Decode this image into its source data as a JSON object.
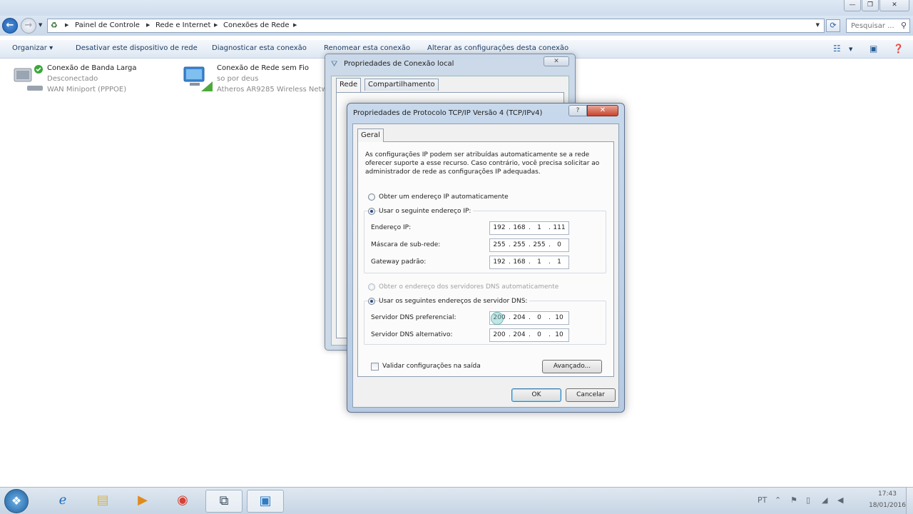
{
  "explorer": {
    "window_controls": {
      "minimize": "—",
      "maximize": "❐",
      "close": "✕"
    },
    "breadcrumb": [
      "Painel de Controle",
      "Rede e Internet",
      "Conexões de Rede"
    ],
    "search_placeholder": "Pesquisar ...",
    "toolbar": {
      "organize": "Organizar ▾",
      "disable": "Desativar este dispositivo de rede",
      "diagnose": "Diagnosticar esta conexão",
      "rename": "Renomear esta conexão",
      "change": "Alterar as configurações desta conexão"
    },
    "connections": [
      {
        "name": "Conexão de Banda Larga",
        "status": "Desconectado",
        "device": "WAN Miniport (PPPOE)"
      },
      {
        "name": "Conexão de Rede sem Fio",
        "status": "so por deus",
        "device": "Atheros AR9285 Wireless Netw"
      }
    ]
  },
  "local_conn_dialog": {
    "title": "Propriedades de Conexão local",
    "close": "✕",
    "tabs": [
      "Rede",
      "Compartilhamento"
    ]
  },
  "tcpip_dialog": {
    "title": "Propriedades de Protocolo TCP/IP Versão 4 (TCP/IPv4)",
    "help": "?",
    "close": "✕",
    "tab": "Geral",
    "intro": "As configurações IP podem ser atribuídas automaticamente se a rede oferecer suporte a esse recurso. Caso contrário, você precisa solicitar ao administrador de rede as configurações IP adequadas.",
    "radio_auto_ip": "Obter um endereço IP automaticamente",
    "radio_manual_ip": "Usar o seguinte endereço IP:",
    "ip_label": "Endereço IP:",
    "ip": [
      "192",
      "168",
      "1",
      "111"
    ],
    "mask_label": "Máscara de sub-rede:",
    "mask": [
      "255",
      "255",
      "255",
      "0"
    ],
    "gateway_label": "Gateway padrão:",
    "gateway": [
      "192",
      "168",
      "1",
      "1"
    ],
    "radio_auto_dns": "Obter o endereço dos servidores DNS automaticamente",
    "radio_manual_dns": "Usar os seguintes endereços de servidor DNS:",
    "dns_pref_label": "Servidor DNS preferencial:",
    "dns_pref": [
      "200",
      "204",
      "0",
      "10"
    ],
    "dns_alt_label": "Servidor DNS alternativo:",
    "dns_alt": [
      "200",
      "204",
      "0",
      "10"
    ],
    "validate_label": "Validar configurações na saída",
    "advanced": "Avançado...",
    "ok": "OK",
    "cancel": "Cancelar"
  },
  "taskbar": {
    "time": "17:43",
    "date": "18/01/2016"
  }
}
